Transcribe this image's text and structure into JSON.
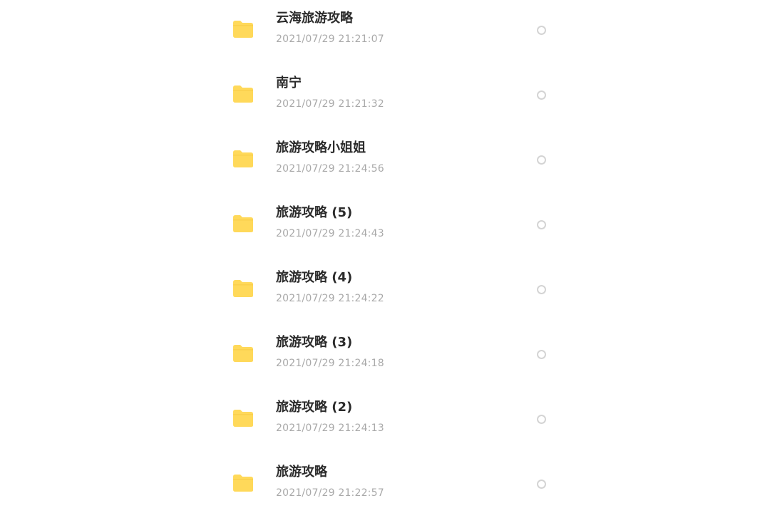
{
  "colors": {
    "folder": "#ffd95a",
    "folder_tab": "#f5c842",
    "name_text": "#2b2b2b",
    "date_text": "#a9a9a9",
    "radio_border": "#d4d4d4"
  },
  "files": [
    {
      "name": "云海旅游攻略",
      "date": "2021/07/29 21:21:07",
      "icon": "folder-icon",
      "selected": false
    },
    {
      "name": "南宁",
      "date": "2021/07/29 21:21:32",
      "icon": "folder-icon",
      "selected": false
    },
    {
      "name": "旅游攻略小姐姐",
      "date": "2021/07/29 21:24:56",
      "icon": "folder-icon",
      "selected": false
    },
    {
      "name": "旅游攻略 (5)",
      "date": "2021/07/29 21:24:43",
      "icon": "folder-icon",
      "selected": false
    },
    {
      "name": "旅游攻略 (4)",
      "date": "2021/07/29 21:24:22",
      "icon": "folder-icon",
      "selected": false
    },
    {
      "name": "旅游攻略 (3)",
      "date": "2021/07/29 21:24:18",
      "icon": "folder-icon",
      "selected": false
    },
    {
      "name": "旅游攻略 (2)",
      "date": "2021/07/29 21:24:13",
      "icon": "folder-icon",
      "selected": false
    },
    {
      "name": "旅游攻略",
      "date": "2021/07/29 21:22:57",
      "icon": "folder-icon",
      "selected": false
    }
  ]
}
